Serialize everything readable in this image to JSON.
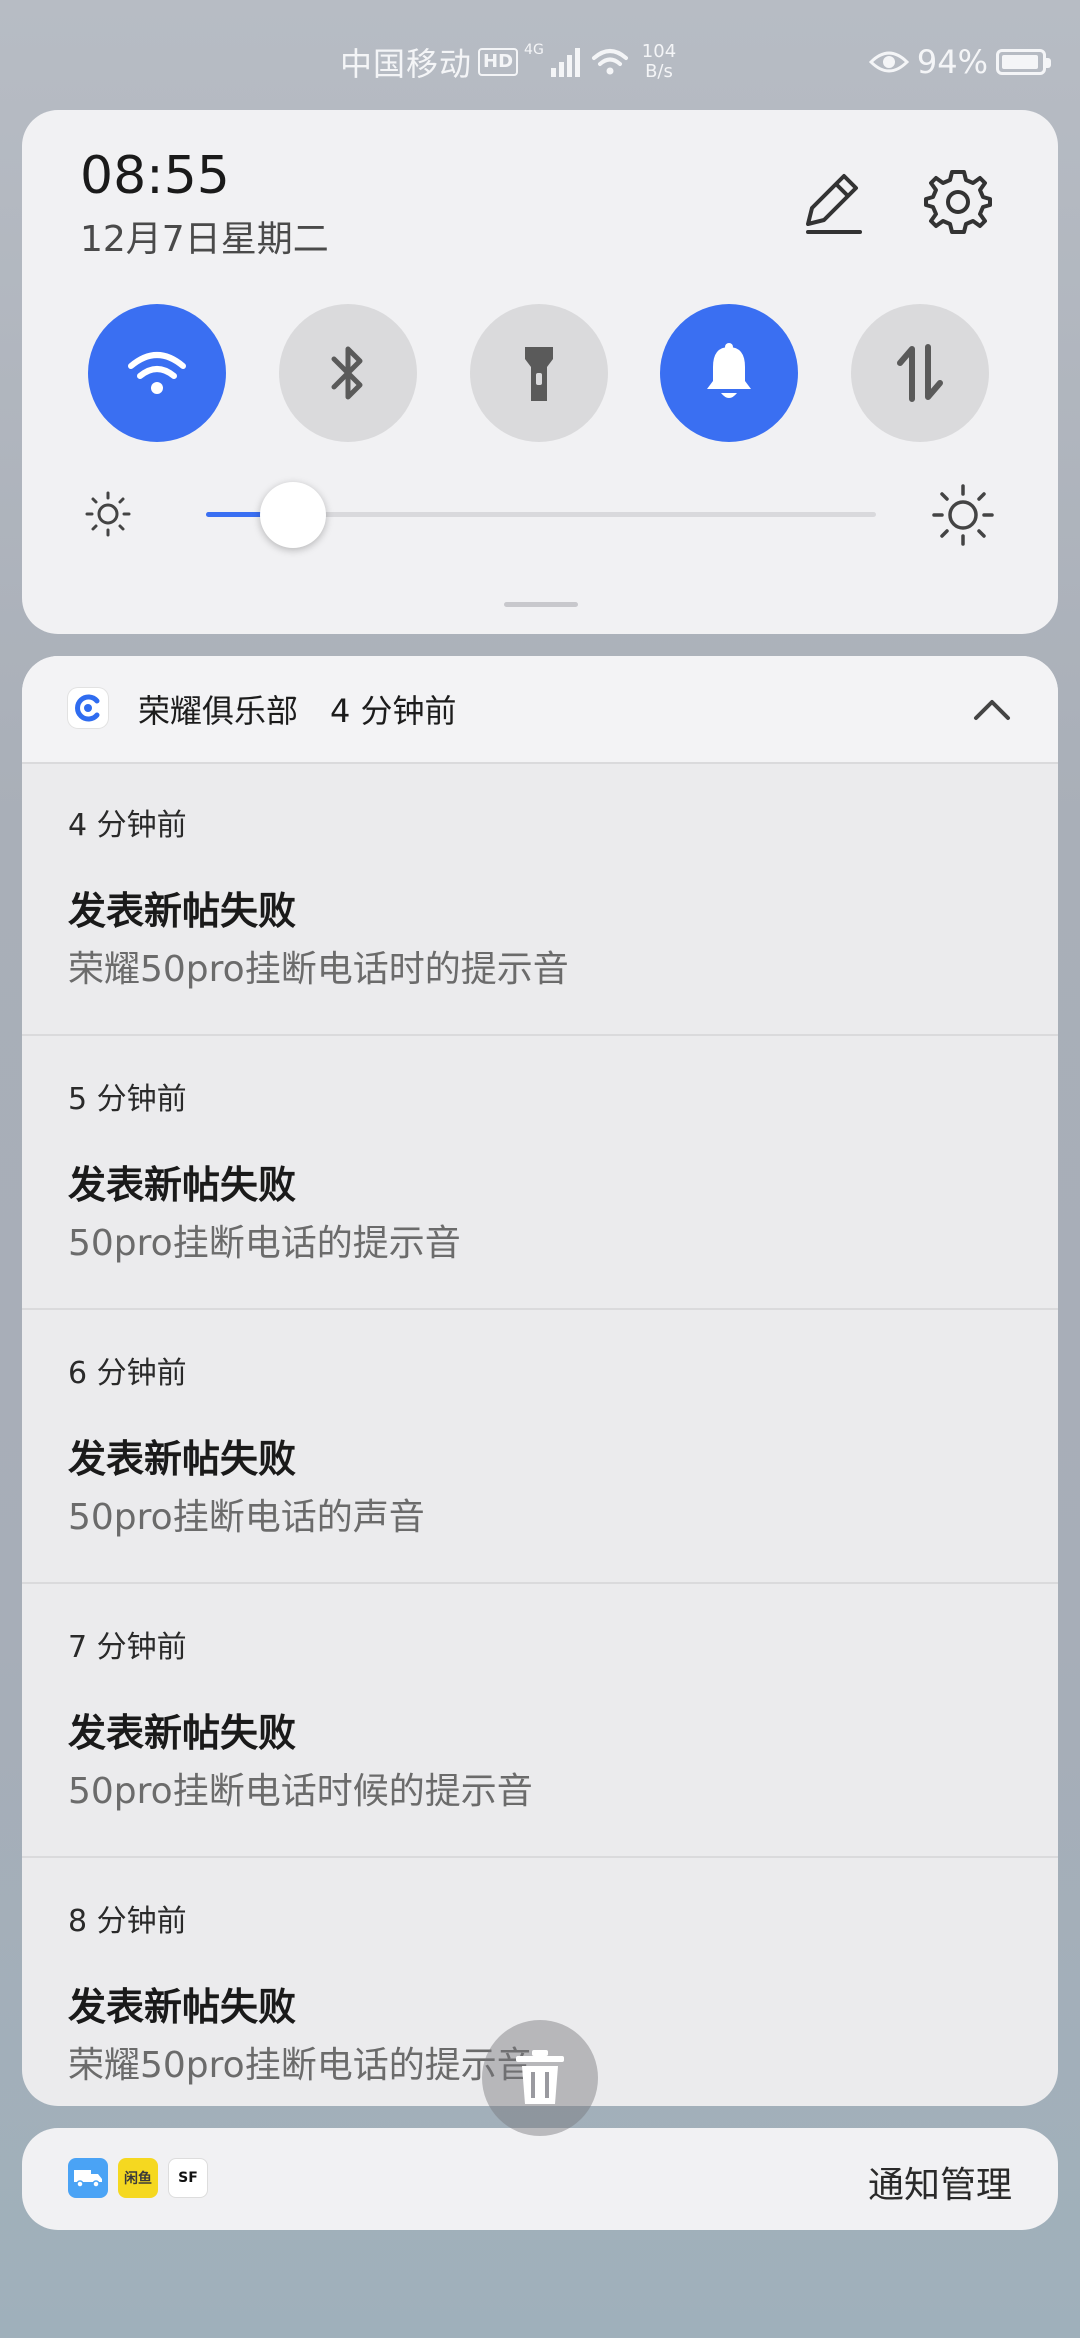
{
  "status_bar": {
    "carrier": "中国移动",
    "hd": "HD",
    "network_type": "4G",
    "speed_value": "104",
    "speed_unit": "B/s",
    "battery_text": "94%",
    "battery_level": 0.94
  },
  "quick_panel": {
    "time": "08:55",
    "date": "12月7日星期二",
    "toggles": [
      {
        "name": "wifi",
        "state": "on"
      },
      {
        "name": "bluetooth",
        "state": "off"
      },
      {
        "name": "flashlight",
        "state": "off"
      },
      {
        "name": "sound",
        "state": "on"
      },
      {
        "name": "mobile-data",
        "state": "off"
      }
    ],
    "brightness_level": 0.13,
    "accent_color": "#3a6ff2"
  },
  "notification_group": {
    "app_name": "荣耀俱乐部",
    "time": "4 分钟前",
    "items": [
      {
        "time": "4 分钟前",
        "title": "发表新帖失败",
        "body": "荣耀50pro挂断电话时的提示音"
      },
      {
        "time": "5 分钟前",
        "title": "发表新帖失败",
        "body": "50pro挂断电话的提示音"
      },
      {
        "time": "6 分钟前",
        "title": "发表新帖失败",
        "body": "50pro挂断电话的声音"
      },
      {
        "time": "7 分钟前",
        "title": "发表新帖失败",
        "body": "50pro挂断电话时候的提示音"
      },
      {
        "time": "8 分钟前",
        "title": "发表新帖失败",
        "body": "荣耀50pro挂断电话的提示音"
      }
    ]
  },
  "footer": {
    "manage_label": "通知管理",
    "icons": [
      "delivery-truck-icon",
      "yellow-app-icon",
      "sf-express-icon"
    ],
    "yellow_app_text": "闲鱼",
    "sf_text": "SF"
  }
}
